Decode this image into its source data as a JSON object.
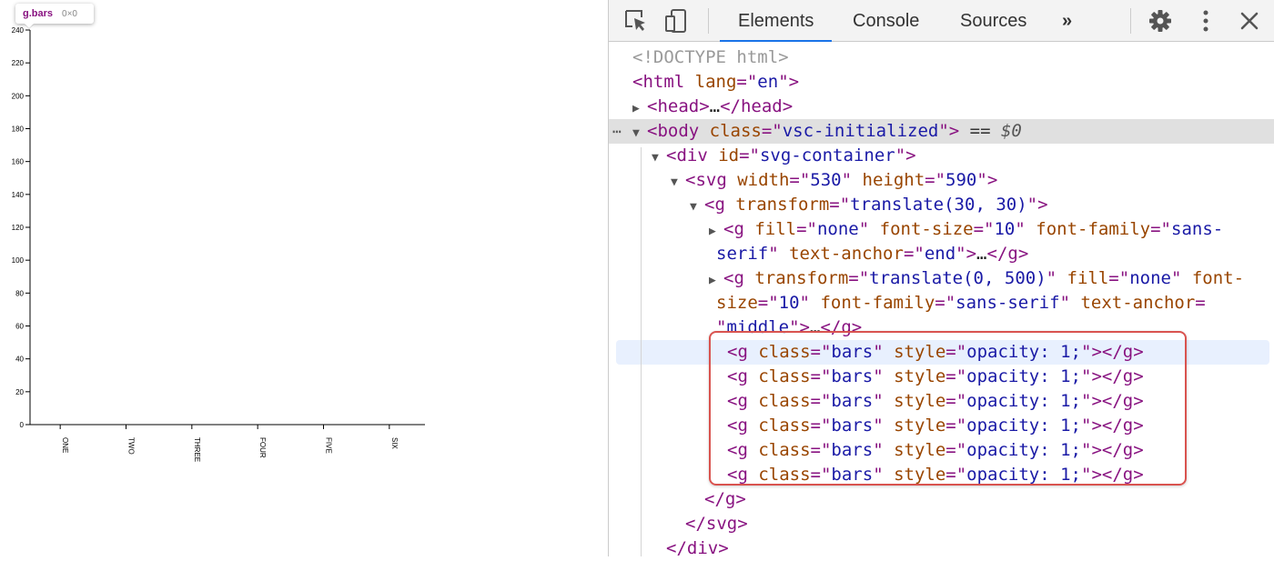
{
  "tooltip": {
    "name": "g.bars",
    "size": "0×0"
  },
  "chart_data": {
    "type": "bar",
    "categories": [
      "ONE",
      "TWO",
      "THREE",
      "FOUR",
      "FIVE",
      "SIX"
    ],
    "values": [],
    "yticks": [
      "0",
      "20",
      "40",
      "60",
      "80",
      "100",
      "120",
      "140",
      "160",
      "180",
      "200",
      "220",
      "240"
    ],
    "ylim": [
      0,
      240
    ]
  },
  "devtools": {
    "tabs": [
      "Elements",
      "Console",
      "Sources"
    ],
    "more_tabs": "»",
    "icons": {
      "inspect": "cursor-select-icon",
      "device": "device-toolbar-icon",
      "settings": "gear-icon",
      "menu": "kebab-menu-icon",
      "close": "close-icon"
    },
    "colors": {
      "accent": "#1a73e8",
      "tag": "#881280",
      "attr": "#994500",
      "value": "#1a1aa6",
      "highlight": "#d9534f"
    },
    "tree": [
      {
        "indent": 0,
        "tri": "",
        "parts": [
          [
            "c-gray",
            "<!DOCTYPE html>"
          ]
        ]
      },
      {
        "indent": 0,
        "tri": "",
        "parts": [
          [
            "c-tag",
            "<html "
          ],
          [
            "c-attr",
            "lang"
          ],
          [
            "c-tag",
            "=\""
          ],
          [
            "c-val",
            "en"
          ],
          [
            "c-tag",
            "\">"
          ]
        ]
      },
      {
        "indent": 0,
        "tri": "▶",
        "parts": [
          [
            "c-tag",
            "<head>"
          ],
          [
            "c-txt",
            "…"
          ],
          [
            "c-tag",
            "</head>"
          ]
        ]
      },
      {
        "indent": 0,
        "tri": "▼",
        "selected": true,
        "parts": [
          [
            "c-tag",
            "<body "
          ],
          [
            "c-attr",
            "class"
          ],
          [
            "c-tag",
            "=\""
          ],
          [
            "c-val",
            "vsc-initialized"
          ],
          [
            "c-tag",
            "\">"
          ],
          [
            "c-eq",
            " == "
          ],
          [
            "c-dollar",
            "$0"
          ]
        ]
      },
      {
        "indent": 1,
        "tri": "▼",
        "parts": [
          [
            "c-tag",
            "<div "
          ],
          [
            "c-attr",
            "id"
          ],
          [
            "c-tag",
            "=\""
          ],
          [
            "c-val",
            "svg-container"
          ],
          [
            "c-tag",
            "\">"
          ]
        ]
      },
      {
        "indent": 2,
        "tri": "▼",
        "parts": [
          [
            "c-tag",
            "<svg "
          ],
          [
            "c-attr",
            "width"
          ],
          [
            "c-tag",
            "=\""
          ],
          [
            "c-val",
            "530"
          ],
          [
            "c-tag",
            "\" "
          ],
          [
            "c-attr",
            "height"
          ],
          [
            "c-tag",
            "=\""
          ],
          [
            "c-val",
            "590"
          ],
          [
            "c-tag",
            "\">"
          ]
        ]
      },
      {
        "indent": 3,
        "tri": "▼",
        "parts": [
          [
            "c-tag",
            "<g "
          ],
          [
            "c-attr",
            "transform"
          ],
          [
            "c-tag",
            "=\""
          ],
          [
            "c-val",
            "translate(30, 30)"
          ],
          [
            "c-tag",
            "\">"
          ]
        ]
      },
      {
        "indent": 4,
        "tri": "▶",
        "parts": [
          [
            "c-tag",
            "<g "
          ],
          [
            "c-attr",
            "fill"
          ],
          [
            "c-tag",
            "=\""
          ],
          [
            "c-val",
            "none"
          ],
          [
            "c-tag",
            "\" "
          ],
          [
            "c-attr",
            "font-size"
          ],
          [
            "c-tag",
            "=\""
          ],
          [
            "c-val",
            "10"
          ],
          [
            "c-tag",
            "\" "
          ],
          [
            "c-attr",
            "font-family"
          ],
          [
            "c-tag",
            "=\""
          ],
          [
            "c-val",
            "sans-"
          ]
        ]
      },
      {
        "indent": 4,
        "tri": "",
        "wrap": true,
        "parts": [
          [
            "c-val",
            "serif"
          ],
          [
            "c-tag",
            "\" "
          ],
          [
            "c-attr",
            "text-anchor"
          ],
          [
            "c-tag",
            "=\""
          ],
          [
            "c-val",
            "end"
          ],
          [
            "c-tag",
            "\">"
          ],
          [
            "c-txt",
            "…"
          ],
          [
            "c-tag",
            "</g>"
          ]
        ]
      },
      {
        "indent": 4,
        "tri": "▶",
        "parts": [
          [
            "c-tag",
            "<g "
          ],
          [
            "c-attr",
            "transform"
          ],
          [
            "c-tag",
            "=\""
          ],
          [
            "c-val",
            "translate(0, 500)"
          ],
          [
            "c-tag",
            "\" "
          ],
          [
            "c-attr",
            "fill"
          ],
          [
            "c-tag",
            "=\""
          ],
          [
            "c-val",
            "none"
          ],
          [
            "c-tag",
            "\" "
          ],
          [
            "c-attr",
            "font-"
          ]
        ]
      },
      {
        "indent": 4,
        "tri": "",
        "wrap": true,
        "parts": [
          [
            "c-attr",
            "size"
          ],
          [
            "c-tag",
            "=\""
          ],
          [
            "c-val",
            "10"
          ],
          [
            "c-tag",
            "\" "
          ],
          [
            "c-attr",
            "font-family"
          ],
          [
            "c-tag",
            "=\""
          ],
          [
            "c-val",
            "sans-serif"
          ],
          [
            "c-tag",
            "\" "
          ],
          [
            "c-attr",
            "text-anchor"
          ],
          [
            "c-tag",
            "="
          ]
        ]
      },
      {
        "indent": 4,
        "tri": "",
        "wrap": true,
        "parts": [
          [
            "c-tag",
            "\""
          ],
          [
            "c-val",
            "middle"
          ],
          [
            "c-tag",
            "\">"
          ],
          [
            "c-txt",
            "…"
          ],
          [
            "c-tag",
            "</g>"
          ]
        ]
      },
      {
        "indent": 4,
        "tri": "",
        "hover": true,
        "bars": true,
        "parts": [
          [
            "c-tag",
            "<g "
          ],
          [
            "c-attr",
            "class"
          ],
          [
            "c-tag",
            "=\""
          ],
          [
            "c-val",
            "bars"
          ],
          [
            "c-tag",
            "\" "
          ],
          [
            "c-attr",
            "style"
          ],
          [
            "c-tag",
            "=\""
          ],
          [
            "c-val",
            "opacity: 1;"
          ],
          [
            "c-tag",
            "\"></g>"
          ]
        ]
      },
      {
        "indent": 4,
        "tri": "",
        "bars": true,
        "parts": [
          [
            "c-tag",
            "<g "
          ],
          [
            "c-attr",
            "class"
          ],
          [
            "c-tag",
            "=\""
          ],
          [
            "c-val",
            "bars"
          ],
          [
            "c-tag",
            "\" "
          ],
          [
            "c-attr",
            "style"
          ],
          [
            "c-tag",
            "=\""
          ],
          [
            "c-val",
            "opacity: 1;"
          ],
          [
            "c-tag",
            "\"></g>"
          ]
        ]
      },
      {
        "indent": 4,
        "tri": "",
        "bars": true,
        "parts": [
          [
            "c-tag",
            "<g "
          ],
          [
            "c-attr",
            "class"
          ],
          [
            "c-tag",
            "=\""
          ],
          [
            "c-val",
            "bars"
          ],
          [
            "c-tag",
            "\" "
          ],
          [
            "c-attr",
            "style"
          ],
          [
            "c-tag",
            "=\""
          ],
          [
            "c-val",
            "opacity: 1;"
          ],
          [
            "c-tag",
            "\"></g>"
          ]
        ]
      },
      {
        "indent": 4,
        "tri": "",
        "bars": true,
        "parts": [
          [
            "c-tag",
            "<g "
          ],
          [
            "c-attr",
            "class"
          ],
          [
            "c-tag",
            "=\""
          ],
          [
            "c-val",
            "bars"
          ],
          [
            "c-tag",
            "\" "
          ],
          [
            "c-attr",
            "style"
          ],
          [
            "c-tag",
            "=\""
          ],
          [
            "c-val",
            "opacity: 1;"
          ],
          [
            "c-tag",
            "\"></g>"
          ]
        ]
      },
      {
        "indent": 4,
        "tri": "",
        "bars": true,
        "parts": [
          [
            "c-tag",
            "<g "
          ],
          [
            "c-attr",
            "class"
          ],
          [
            "c-tag",
            "=\""
          ],
          [
            "c-val",
            "bars"
          ],
          [
            "c-tag",
            "\" "
          ],
          [
            "c-attr",
            "style"
          ],
          [
            "c-tag",
            "=\""
          ],
          [
            "c-val",
            "opacity: 1;"
          ],
          [
            "c-tag",
            "\"></g>"
          ]
        ]
      },
      {
        "indent": 4,
        "tri": "",
        "bars": true,
        "parts": [
          [
            "c-tag",
            "<g "
          ],
          [
            "c-attr",
            "class"
          ],
          [
            "c-tag",
            "=\""
          ],
          [
            "c-val",
            "bars"
          ],
          [
            "c-tag",
            "\" "
          ],
          [
            "c-attr",
            "style"
          ],
          [
            "c-tag",
            "=\""
          ],
          [
            "c-val",
            "opacity: 1;"
          ],
          [
            "c-tag",
            "\"></g>"
          ]
        ]
      },
      {
        "indent": 3,
        "tri": "",
        "parts": [
          [
            "c-tag",
            "</g>"
          ]
        ]
      },
      {
        "indent": 2,
        "tri": "",
        "parts": [
          [
            "c-tag",
            "</svg>"
          ]
        ]
      },
      {
        "indent": 1,
        "tri": "",
        "parts": [
          [
            "c-tag",
            "</div>"
          ]
        ]
      }
    ]
  }
}
